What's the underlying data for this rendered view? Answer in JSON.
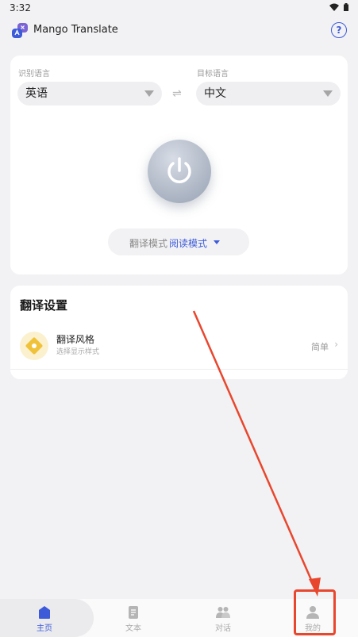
{
  "status": {
    "time": "3:32"
  },
  "app": {
    "title": "Mango Translate",
    "help_glyph": "?"
  },
  "translate": {
    "source_label": "识别语言",
    "target_label": "目标语言",
    "source_language": "英语",
    "target_language": "中文",
    "swap_glyph": "⇌",
    "mode_label": "翻译模式",
    "mode_value": "阅读模式"
  },
  "settings": {
    "title": "翻译设置",
    "style_name": "翻译风格",
    "style_desc": "选择显示样式",
    "style_value": "简单",
    "chevron": "›"
  },
  "tabs": [
    {
      "label": "主页",
      "icon": "home-icon",
      "active": true
    },
    {
      "label": "文本",
      "icon": "document-icon",
      "active": false
    },
    {
      "label": "对话",
      "icon": "conversation-icon",
      "active": false
    },
    {
      "label": "我的",
      "icon": "profile-icon",
      "active": false
    }
  ],
  "colors": {
    "accent": "#3d5bd9",
    "annotation": "#e8472e",
    "style_icon": "#f0c23a"
  }
}
